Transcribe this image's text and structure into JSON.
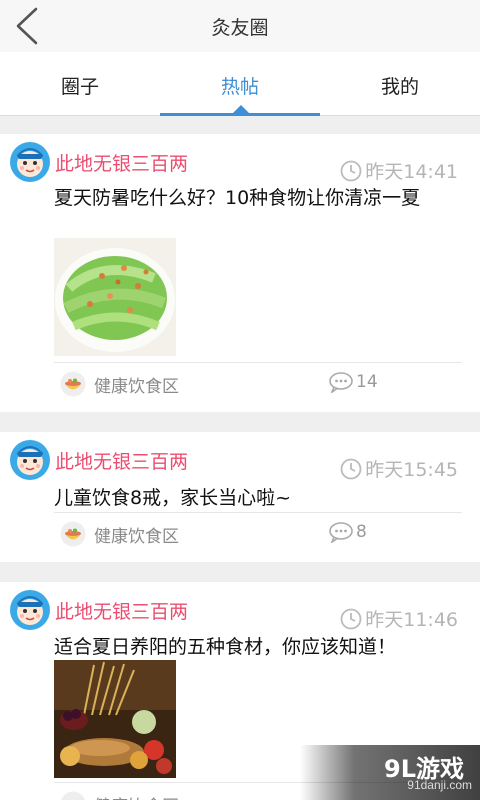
{
  "header": {
    "title": "灸友圈",
    "back_icon": "chevron-left-icon"
  },
  "tabs": [
    {
      "label": "圈子",
      "active": false
    },
    {
      "label": "热帖",
      "active": true
    },
    {
      "label": "我的",
      "active": false
    }
  ],
  "accent_color": "#3d8fd6",
  "author_color": "#ec4d6f",
  "posts": [
    {
      "author": "此地无银三百两",
      "time": "昨天14:41",
      "title": "夏天防暑吃什么好？10种食物让你清凉一夏",
      "has_image": true,
      "image_desc": "icon:stir-fried-gourd-dish",
      "category": "健康饮食区",
      "comments": "14"
    },
    {
      "author": "此地无银三百两",
      "time": "昨天15:45",
      "title": "儿童饮食8戒，家长当心啦~",
      "has_image": false,
      "category": "健康饮食区",
      "comments": "8"
    },
    {
      "author": "此地无银三百两",
      "time": "昨天11:46",
      "title": "适合夏日养阳的五种食材，你应该知道！",
      "has_image": true,
      "image_desc": "icon:bread-and-produce",
      "category": "健康饮食区",
      "comments": ""
    }
  ],
  "watermark": {
    "logo": "9L游戏",
    "url": "91danji.com"
  }
}
